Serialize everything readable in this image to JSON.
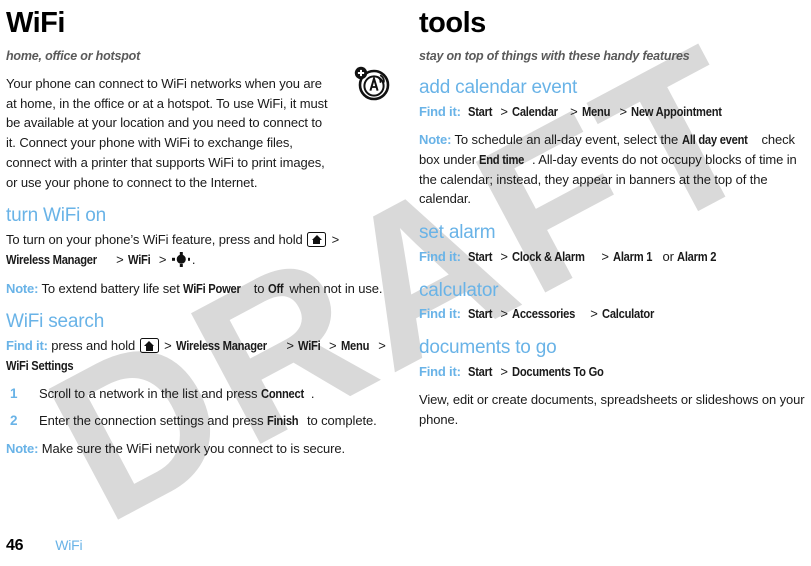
{
  "watermark": {
    "text": "DRAFT",
    "color": "#d9d9d9"
  },
  "accent_color": "#69b3e7",
  "footer": {
    "page_number": "46",
    "chapter": "WiFi"
  },
  "left_column": {
    "title": "WiFi",
    "tagline": "home, office or hotspot",
    "feature_icon": "wifi-antenna-add-icon",
    "intro": "Your phone can connect to WiFi networks when you are at home, in the office or at a hotspot. To use WiFi, it must be available at your location and you need to connect to it. Connect your phone with WiFi to exchange files, connect with a printer that supports WiFi to print images, or use your phone to connect to the Internet.",
    "sections": [
      {
        "heading": "turn WiFi on",
        "instruction_prefix": "To turn on your phone’s WiFi feature, press and hold",
        "path": [
          "Wireless Manager",
          "WiFi"
        ],
        "note_label": "Note:",
        "note_prefix": "To extend battery life set",
        "note_term1": "WiFi Power",
        "note_mid": "to",
        "note_term2": "Off",
        "note_suffix": "when not in use."
      },
      {
        "heading": "WiFi search",
        "find_it_label": "Find it:",
        "find_it_prefix": "press and hold",
        "path": [
          "Wireless Manager",
          "WiFi",
          "Menu",
          "WiFi Settings"
        ],
        "steps": [
          {
            "num": "1",
            "prefix": "Scroll to a network in the list and press",
            "term": "Connect",
            "suffix": "."
          },
          {
            "num": "2",
            "prefix": "Enter the connection settings and press",
            "term": "Finish",
            "suffix": "to complete."
          }
        ],
        "note_label": "Note:",
        "note_text": "Make sure the WiFi network you connect to is secure."
      }
    ]
  },
  "right_column": {
    "title": "tools",
    "tagline": "stay on top of things with these handy features",
    "sections": [
      {
        "heading": "add calendar event",
        "find_it_label": "Find it:",
        "path": [
          "Start",
          "Calendar",
          "Menu",
          "New Appointment"
        ],
        "note_label": "Note:",
        "note_part1": "To schedule an all-day event, select the",
        "note_term1": "All day event",
        "note_part2": "check box under",
        "note_term2": "End time",
        "note_part3": ". All-day events do not occupy blocks of time in the calendar; instead, they appear in banners at the top of the calendar."
      },
      {
        "heading": "set alarm",
        "find_it_label": "Find it:",
        "path": [
          "Start",
          "Clock & Alarm",
          "Alarm 1"
        ],
        "or_word": "or",
        "path_alt": "Alarm 2"
      },
      {
        "heading": "calculator",
        "find_it_label": "Find it:",
        "path": [
          "Start",
          "Accessories",
          "Calculator"
        ]
      },
      {
        "heading": "documents to go",
        "find_it_label": "Find it:",
        "path": [
          "Start",
          "Documents To Go"
        ],
        "body": "View, edit or create documents, spreadsheets or slideshows on your phone."
      }
    ]
  }
}
